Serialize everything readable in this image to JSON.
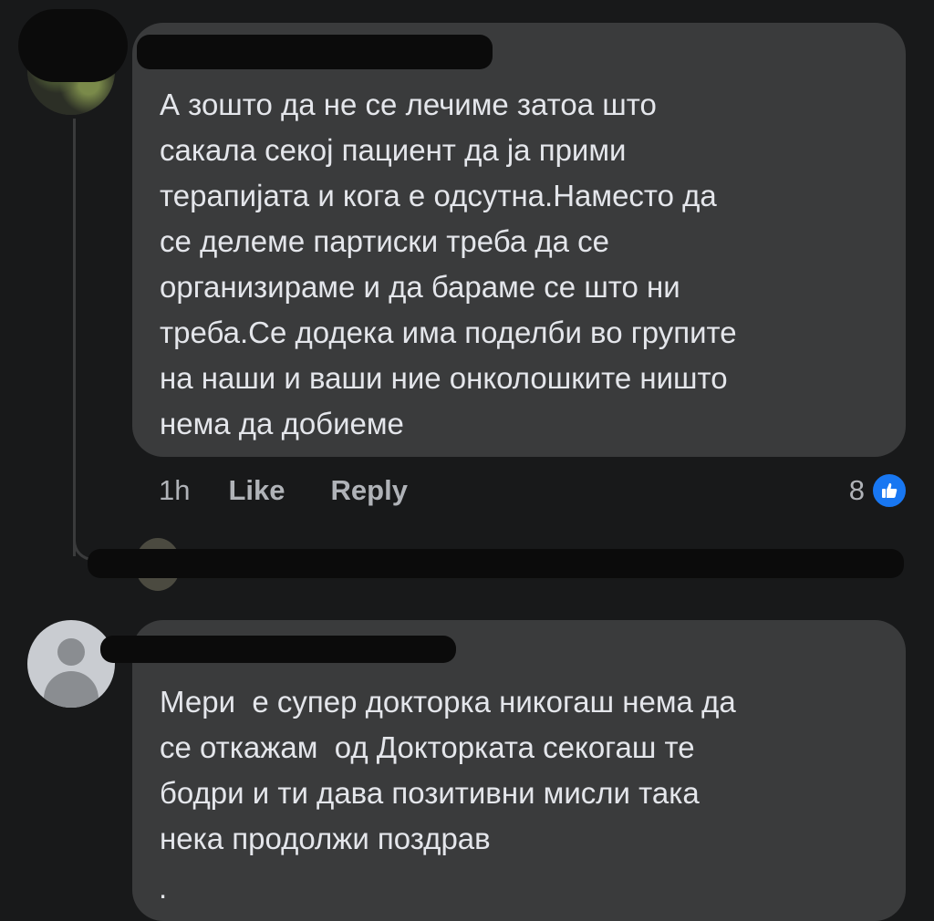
{
  "comment_1": {
    "text": "А зошто да не се лечиме затоа што\nсакала секој пациент да ја прими\nтерапијата и кога е одсутна.Наместо да\nсе делеме партиски треба да се\nорганизираме и да бараме се што ни\nтреба.Се додека има поделби во групите\nна наши и ваши ние онколошките ништо\nнема да добиеме",
    "time": "1h",
    "like_label": "Like",
    "reply_label": "Reply",
    "reaction_count": "8",
    "reaction_icon": "thumbs-up-icon",
    "reaction_color": "#1877f2"
  },
  "comment_2": {
    "text": "Мери  е супер докторка никогаш нема да\nсе откажам  од Докторката секогаш те\nбодри и ти дава позитивни мисли така\nнека продолжи поздрав",
    "trailing": "."
  },
  "theme": {
    "background": "#18191a",
    "bubble": "#3a3b3c",
    "text": "#e4e6eb",
    "muted": "#b0b3b8"
  }
}
